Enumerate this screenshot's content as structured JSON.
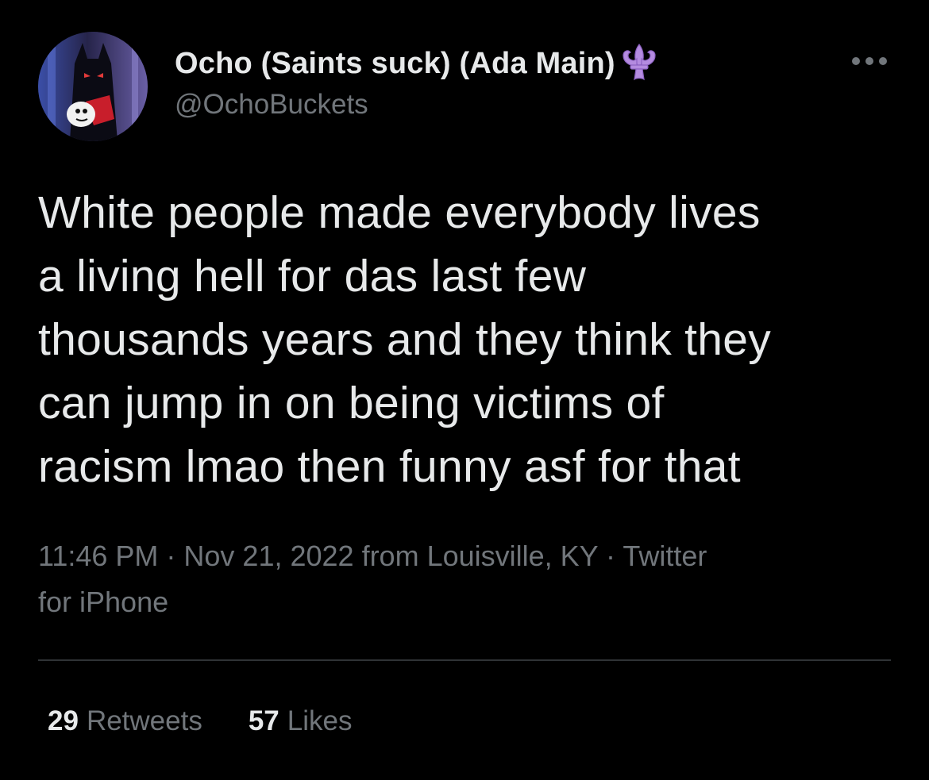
{
  "tweet": {
    "display_name": "Ocho (Saints suck) (Ada Main)",
    "handle": "@OchoBuckets",
    "badge_icon": "fleur-de-lis-icon",
    "more_icon": "more-options-icon",
    "text": "White people made everybody lives\na living hell for das last few\nthousands years and they think they\ncan jump in on being victims of\nracism lmao then funny asf for that",
    "meta": "11:46 PM · Nov 21, 2022 from Louisville, KY · Twitter\nfor iPhone",
    "stats": {
      "retweets_count": "29",
      "retweets_label": "Retweets",
      "likes_count": "57",
      "likes_label": "Likes"
    }
  },
  "colors": {
    "background": "#000000",
    "primary_text": "#e7e9ea",
    "secondary_text": "#71767b",
    "divider": "#2f3336",
    "badge": "#b48be0"
  }
}
